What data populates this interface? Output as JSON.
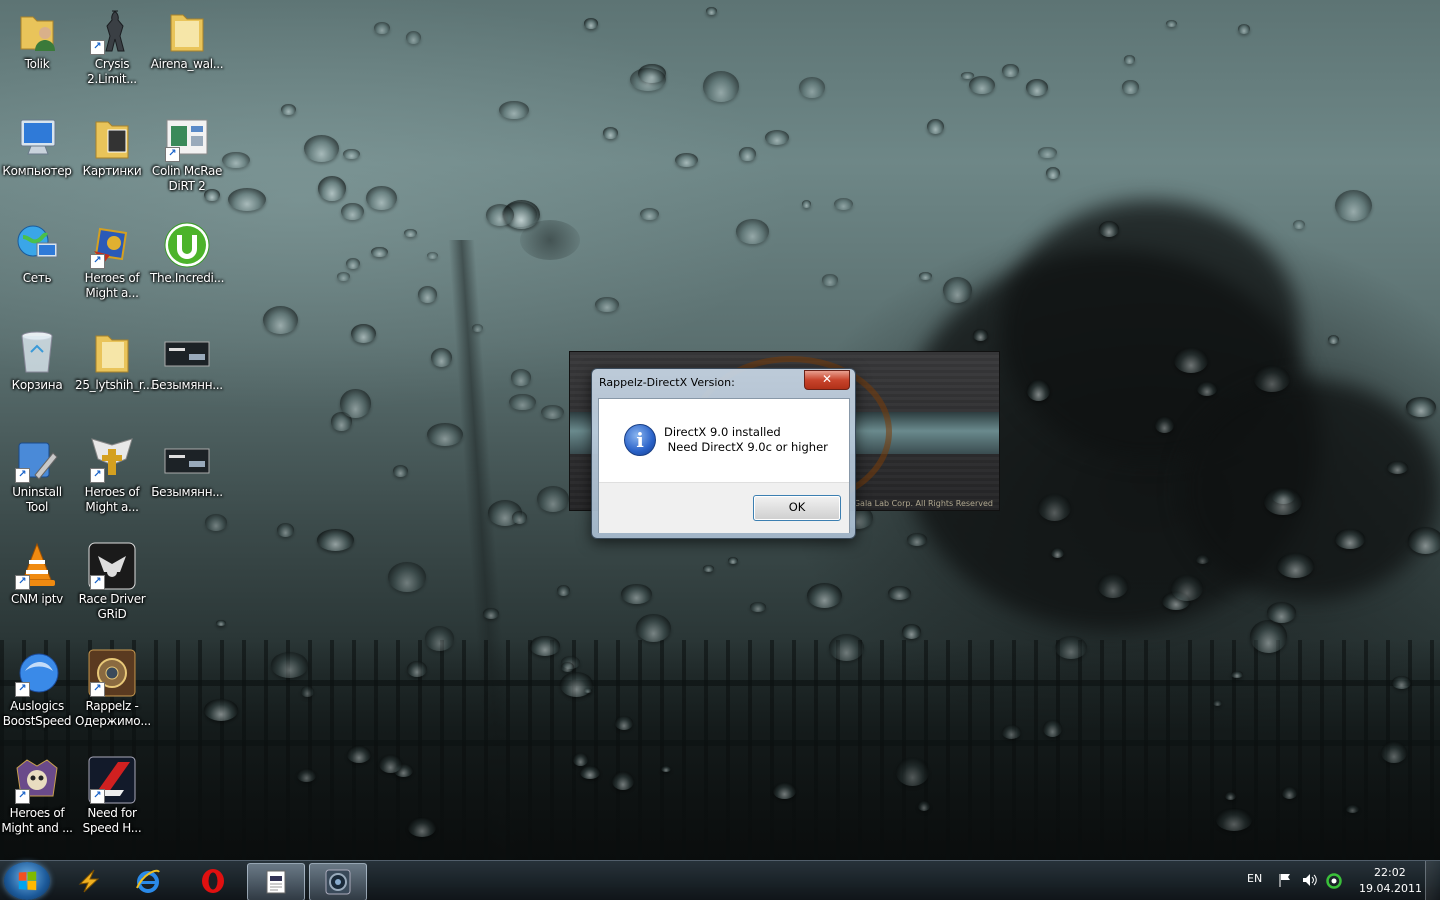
{
  "desktop": {
    "icons": [
      {
        "label": "Tolik",
        "icon": "user-folder-icon"
      },
      {
        "label": "Crysis 2.Limit...",
        "icon": "crysis-icon"
      },
      {
        "label": "Airena_wal...",
        "icon": "folder-icon"
      },
      {
        "label": "Компьютер",
        "icon": "computer-icon"
      },
      {
        "label": "Картинки",
        "icon": "pictures-folder-icon"
      },
      {
        "label": "Colin McRae DiRT 2",
        "icon": "dirt2-icon"
      },
      {
        "label": "Сеть",
        "icon": "network-icon"
      },
      {
        "label": "Heroes of Might a...",
        "icon": "heroes-icon"
      },
      {
        "label": "The.Incredi...",
        "icon": "utorrent-icon"
      },
      {
        "label": "Корзина",
        "icon": "recycle-bin-icon"
      },
      {
        "label": "25_lytshih_r...",
        "icon": "folder-icon"
      },
      {
        "label": "Безымянн...",
        "icon": "image-file-icon"
      },
      {
        "label": "Uninstall Tool",
        "icon": "uninstall-tool-icon"
      },
      {
        "label": "Heroes of Might a...",
        "icon": "heroes-angel-icon"
      },
      {
        "label": "Безымянн...",
        "icon": "image-file-icon"
      },
      {
        "label": "CNM iptv",
        "icon": "vlc-icon"
      },
      {
        "label": "Race Driver GRiD",
        "icon": "grid-icon"
      },
      {
        "label": "Auslogics BoostSpeed",
        "icon": "auslogics-icon"
      },
      {
        "label": "Rappelz - Одержимо...",
        "icon": "rappelz-icon"
      },
      {
        "label": "Heroes of Might and ...",
        "icon": "heroes-skull-icon"
      },
      {
        "label": "Need for Speed H...",
        "icon": "nfs-icon"
      }
    ]
  },
  "splash": {
    "copyright": "Gala Lab Corp. All Rights Reserved"
  },
  "dialog": {
    "title": "Rappelz-DirectX Version:",
    "close_label": "✕",
    "message": "DirectX 9.0 installed\n Need DirectX 9.0c or higher",
    "ok_label": "OK",
    "icon": "information-icon"
  },
  "taskbar": {
    "items": [
      "start-button",
      "pinned-app",
      "internet-explorer",
      "opera",
      "notepad-document",
      "rappelz-launcher"
    ],
    "tray": {
      "language": "EN",
      "time": "22:02",
      "date": "19.04.2011"
    }
  },
  "colors": {
    "close_button": "#c8442c",
    "ok_border": "#3c7fb1",
    "info_icon": "#2a62c8"
  }
}
